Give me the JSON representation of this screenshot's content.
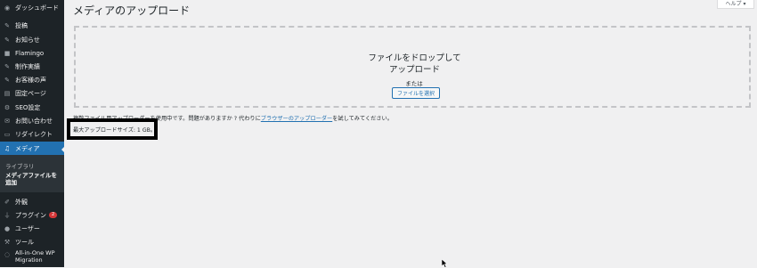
{
  "sidebar": {
    "items": [
      {
        "label": "ダッシュボード",
        "icon": "dashboard-icon"
      },
      {
        "label": "投稿",
        "icon": "pin-icon"
      },
      {
        "label": "お知らせ",
        "icon": "pin-icon"
      },
      {
        "label": "Flamingo",
        "icon": "flamingo-icon"
      },
      {
        "label": "制作実績",
        "icon": "pin-icon"
      },
      {
        "label": "お客様の声",
        "icon": "pin-icon"
      },
      {
        "label": "固定ページ",
        "icon": "page-icon"
      },
      {
        "label": "SEO設定",
        "icon": "gear-icon"
      },
      {
        "label": "お問い合わせ",
        "icon": "mail-icon"
      },
      {
        "label": "リダイレクト",
        "icon": "redirect-icon"
      },
      {
        "label": "メディア",
        "icon": "media-icon"
      },
      {
        "label": "外観",
        "icon": "brush-icon"
      },
      {
        "label": "プラグイン",
        "icon": "plugin-icon",
        "badge": "2"
      },
      {
        "label": "ユーザー",
        "icon": "user-icon"
      },
      {
        "label": "ツール",
        "icon": "wrench-icon"
      },
      {
        "label": "All-in-One WP Migration",
        "icon": "migration-icon"
      }
    ],
    "submenu": [
      "ライブラリ",
      "メディアファイルを追加"
    ]
  },
  "header": {
    "title": "メディアのアップロード",
    "help_label": "ヘルプ ▾"
  },
  "dropzone": {
    "title": "ファイルをドロップしてアップロード",
    "title_line1": "ファイルをドロップしてア",
    "title_line2": "ップロード",
    "or_text": "または",
    "select_button": "ファイルを選択"
  },
  "uploader_note": {
    "text": "複数ファイル用アップローダーを使用中です。問題がありますか ? 代わりに",
    "link": "ブラウザーのアップローダー",
    "suffix": "を試してみてください。"
  },
  "max_upload": "最大アップロードサイズ: 1 GB。",
  "colors": {
    "sidebar_bg": "#1d2327",
    "accent": "#2271b1",
    "page_bg": "#f0f0f1",
    "badge": "#d63638"
  }
}
